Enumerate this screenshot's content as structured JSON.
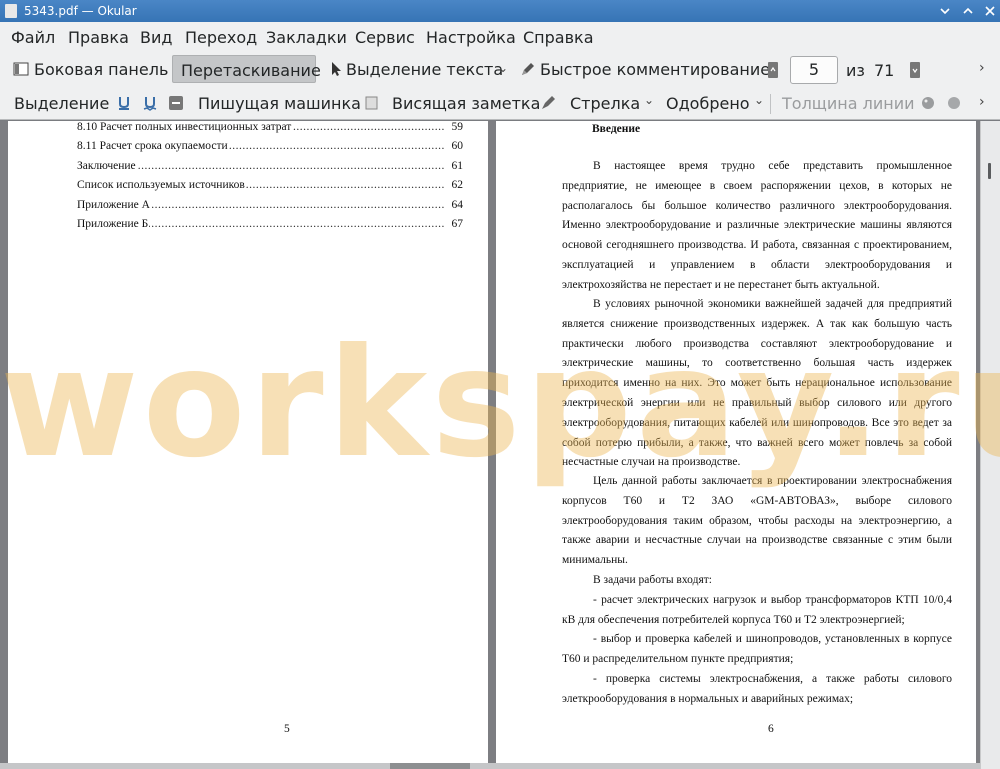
{
  "window": {
    "title": "5343.pdf  — Okular"
  },
  "menu": {
    "items": [
      "Файл",
      "Правка",
      "Вид",
      "Переход",
      "Закладки",
      "Сервис",
      "Настройка",
      "Справка"
    ]
  },
  "toolbar1": {
    "sidebar": "Боковая панель",
    "drag": "Перетаскивание",
    "text_select": "Выделение текста",
    "quick_comment": "Быстрое комментирование",
    "page_current": "5",
    "page_of": "из",
    "page_total": "71"
  },
  "toolbar2": {
    "highlight": "Выделение",
    "typewriter": "Пишущая машинка",
    "inline_note": "Висящая заметка",
    "arrow": "Стрелка",
    "approved": "Одобрено",
    "line_width": "Толщина линии"
  },
  "page5": {
    "toc": [
      {
        "title": "8.10 Расчет полных инвестиционных затрат",
        "page": "59"
      },
      {
        "title": "8.11 Расчет срока окупаемости",
        "page": "60"
      },
      {
        "title": "Заключение",
        "page": "61"
      },
      {
        "title": "Список используемых источников",
        "page": "62"
      },
      {
        "title": "Приложение А",
        "page": "64"
      },
      {
        "title": "Приложение Б",
        "page": "67"
      }
    ],
    "page_number": "5"
  },
  "page6": {
    "heading": "Введение",
    "paragraphs": [
      "В настоящее время трудно себе представить промышленное предприятие, не имеющее в своем распоряжении цехов, в которых не располагалось бы большое количество различного электрооборудования. Именно электрооборудование и различные электрические машины являются основой сегодняшнего производства. И работа, связанная с проектированием, эксплуатацией и управлением в области электрооборудования и электрохозяйства не перестает и не перестанет быть актуальной.",
      "В условиях рыночной экономики важнейшей задачей для предприятий является снижение производственных издержек. А так как большую часть практически любого производства составляют электрооборудование и электрические машины, то соответственно большая часть издержек приходится именно на них. Это может быть нерациональное использование электрической энергии или не правильный выбор силового или другого электрооборудования, питающих кабелей или шинопроводов. Все это ведет за собой потерю прибыли, а также, что важней всего может повлечь за собой несчастные случаи на производстве.",
      "Цель данной работы заключается в проектировании электроснабжения корпусов Т60 и Т2 ЗАО «GM-АВТОВАЗ», выборе силового электрооборудования таким образом, чтобы расходы на электроэнергию, а также аварии и несчастные случаи на производстве связанные с этим были минимальны.",
      "В задачи работы входят:",
      "- расчет электрических нагрузок и выбор трансформаторов КТП 10/0,4 кВ для обеспечения потребителей корпуса Т60 и Т2 электроэнергией;",
      "- выбор и проверка кабелей и шинопроводов, установленных в корпусе Т60 и распределительном пункте предприятия;",
      "- проверка системы электроснабжения, а также работы силового элеткрооборудования в нормальных и аварийных режимах;"
    ],
    "page_number": "6"
  },
  "watermark": "workspay.ru"
}
